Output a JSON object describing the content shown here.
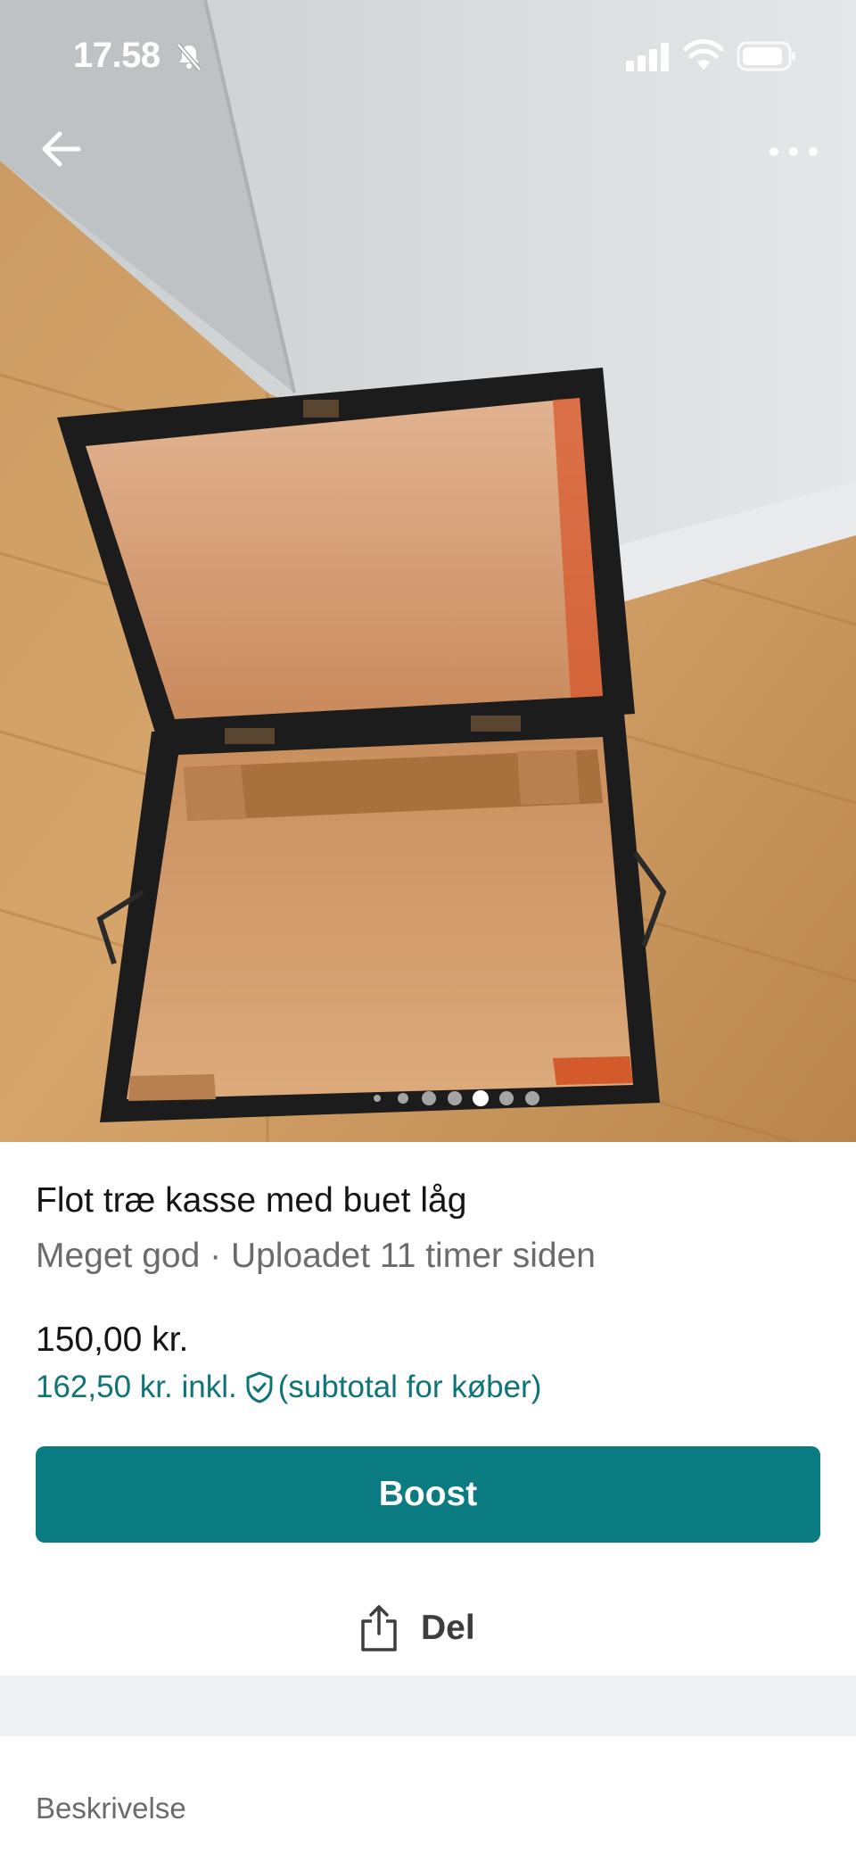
{
  "status_bar": {
    "time": "17.58"
  },
  "photo": {
    "carousel": {
      "count": 7,
      "active_index": 4
    }
  },
  "listing": {
    "title": "Flot træ kasse med buet låg",
    "subtitle": "Meget god · Uploadet 11 timer siden",
    "price": "150,00 kr.",
    "price_incl": "162,50 kr. inkl.",
    "price_incl_note": "(subtotal for køber)"
  },
  "actions": {
    "boost_label": "Boost",
    "share_label": "Del"
  },
  "description": {
    "heading": "Beskrivelse"
  },
  "colors": {
    "accent": "#0a7b80",
    "accent_text": "#0f7478",
    "divider": "#eef1f2"
  },
  "icons": [
    "bell-slash-icon",
    "signal-icon",
    "wifi-icon",
    "battery-icon",
    "arrow-left-icon",
    "more-horizontal-icon",
    "shield-check-icon",
    "share-icon"
  ]
}
